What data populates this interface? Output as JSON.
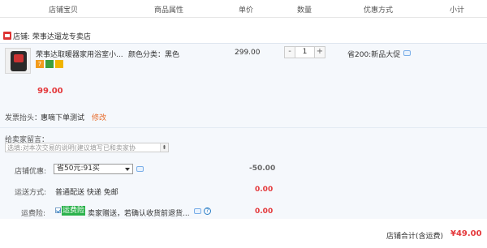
{
  "header": {
    "columns": [
      "店铺宝贝",
      "商品属性",
      "单价",
      "数量",
      "优惠方式",
      "小计"
    ]
  },
  "shop": {
    "label": "店铺: ",
    "name": "荣事达遛龙专卖店"
  },
  "item": {
    "title": "荣事达取暖器家用浴室小...",
    "attr": "颜色分类：黑色",
    "unit_price": "299.00",
    "quantity": "1",
    "minus": "-",
    "plus": "+",
    "promo": "省200:新品大促",
    "subtotal": "99.00",
    "badges": [
      "7",
      "",
      ""
    ]
  },
  "invoice": {
    "label": "发票抬头：",
    "value": "惠嘀下单测试",
    "edit": "修改"
  },
  "message": {
    "label": "给卖家留言：",
    "placeholder": "选填:对本次交易的说明(建议填写已和卖家协",
    "arrow": "⬍"
  },
  "coupon": {
    "label": "店铺优惠:",
    "selected": "省50元:91买",
    "amount": "-50.00"
  },
  "shipping": {
    "label": "运送方式:",
    "value": "普通配送 快递 免邮",
    "amount": "0.00"
  },
  "insurance": {
    "label": "运费险:",
    "tag": "运费险",
    "text": "卖家赠送，若确认收货前退货...",
    "help": "?",
    "amount": "0.00"
  },
  "footer": {
    "label": "店铺合计(含运费)",
    "total": "¥49.00"
  },
  "colors": {
    "price_red": "#e4393c",
    "link_orange": "#e86a29",
    "panel_bg": "#f5f8fc",
    "insurance_green": "#2bb24c"
  }
}
